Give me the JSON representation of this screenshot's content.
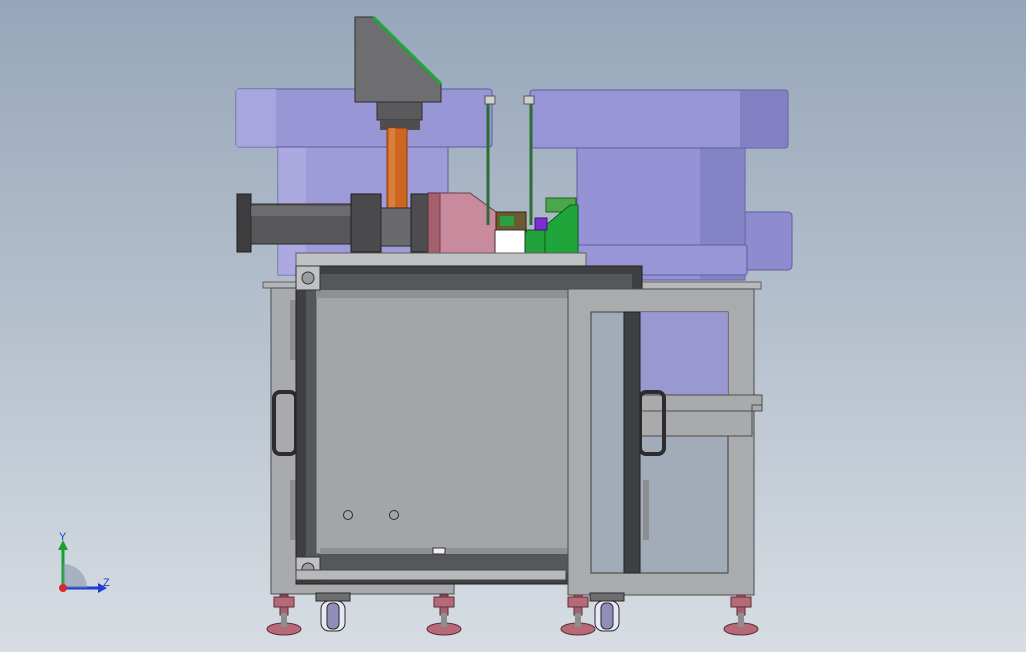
{
  "view": {
    "background_top": "#96a6ba",
    "background_bottom": "#d7dde3"
  },
  "model": {
    "colors": {
      "frame_gray": "#a9abad",
      "frame_dark": "#4b4d4f",
      "bowl_lavender": "#9d9bd8",
      "bowl_shadow": "#6f6db0",
      "cylinder_dark": "#555557",
      "pink_block": "#c98a9d",
      "green_part": "#1fa53a",
      "orange_rod": "#cc6620",
      "foot_pink": "#b66a78",
      "purple_part": "#7a2fd0"
    }
  },
  "triad": {
    "y_label": "Y",
    "z_label": "Z",
    "icon": "coordinate-triad-icon"
  }
}
